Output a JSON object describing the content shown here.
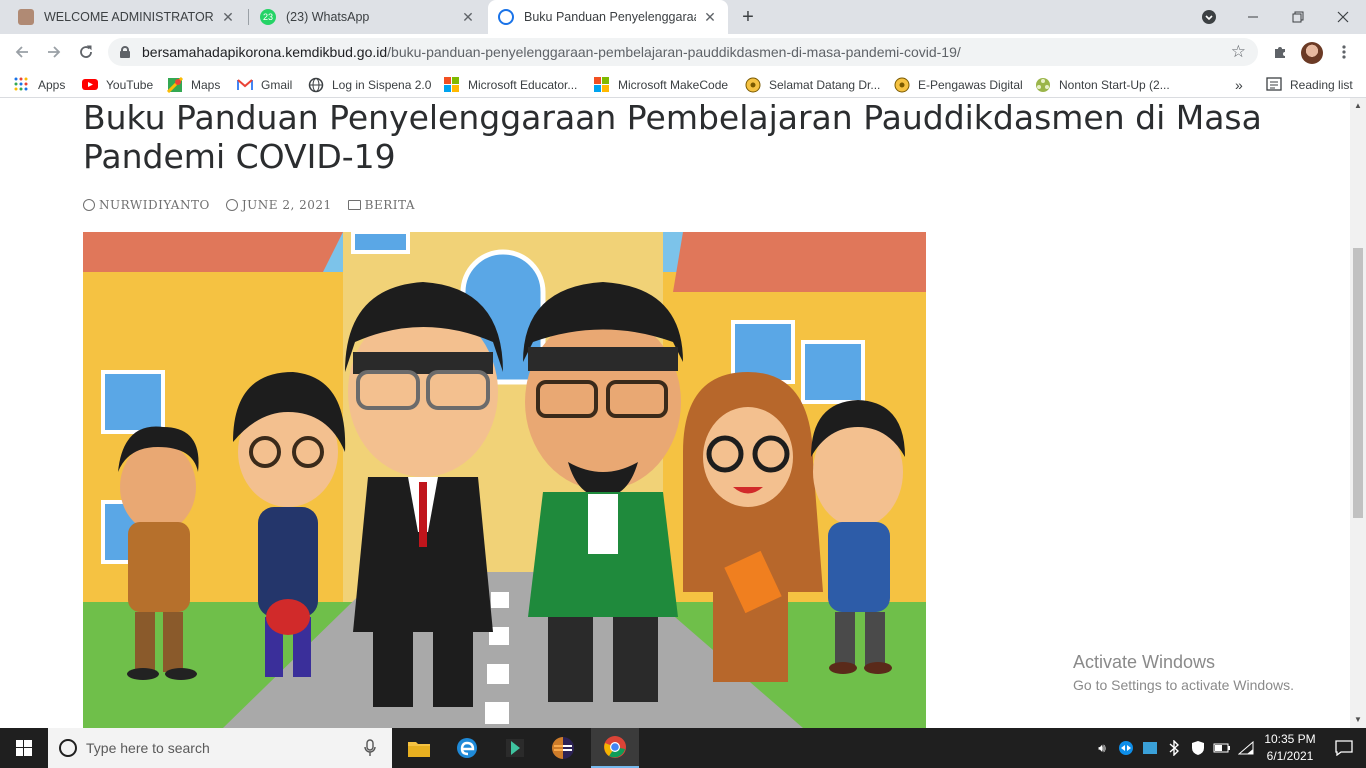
{
  "tabs": [
    {
      "title": "WELCOME ADMINISTRATOR",
      "icon": "person-photo-icon"
    },
    {
      "title": "(23) WhatsApp",
      "icon": "whatsapp-icon",
      "badge": "23"
    },
    {
      "title": "Buku Panduan Penyelenggaraan",
      "icon": "kemdikbud-icon"
    }
  ],
  "omnibox": {
    "host": "bersamahadapikorona.kemdikbud.go.id",
    "path": "/buku-panduan-penyelenggaraan-pembelajaran-pauddikdasmen-di-masa-pandemi-covid-19/"
  },
  "bookmarks": [
    {
      "label": "Apps",
      "icon": "apps-grid-icon"
    },
    {
      "label": "YouTube",
      "icon": "youtube-icon"
    },
    {
      "label": "Maps",
      "icon": "maps-icon"
    },
    {
      "label": "Gmail",
      "icon": "gmail-icon"
    },
    {
      "label": "Log in Sispena 2.0",
      "icon": "globe-icon"
    },
    {
      "label": "Microsoft Educator...",
      "icon": "microsoft-icon"
    },
    {
      "label": "Microsoft MakeCode",
      "icon": "microsoft-icon"
    },
    {
      "label": "Selamat Datang Dr...",
      "icon": "tutwuri-icon"
    },
    {
      "label": "E-Pengawas Digital",
      "icon": "tutwuri-icon"
    },
    {
      "label": "Nonton Start-Up (2...",
      "icon": "film-icon"
    }
  ],
  "reading_list": "Reading list",
  "overflow": "»",
  "post": {
    "title": "Buku Panduan Penyelenggaraan Pembelajaran Pauddikdasmen di Masa Pandemi COVID-19",
    "author": "NURWIDIYANTO",
    "date": "JUNE 2, 2021",
    "category": "BERITA"
  },
  "activate": {
    "title": "Activate Windows",
    "subtitle": "Go to Settings to activate Windows."
  },
  "taskbar": {
    "search_placeholder": "Type here to search",
    "time": "10:35 PM",
    "date": "6/1/2021"
  },
  "colors": {
    "tabstrip": "#dee1e6",
    "youtube": "#ff0000",
    "whatsapp": "#25d366",
    "building_yellow": "#f5c242",
    "roof": "#e0775a"
  }
}
